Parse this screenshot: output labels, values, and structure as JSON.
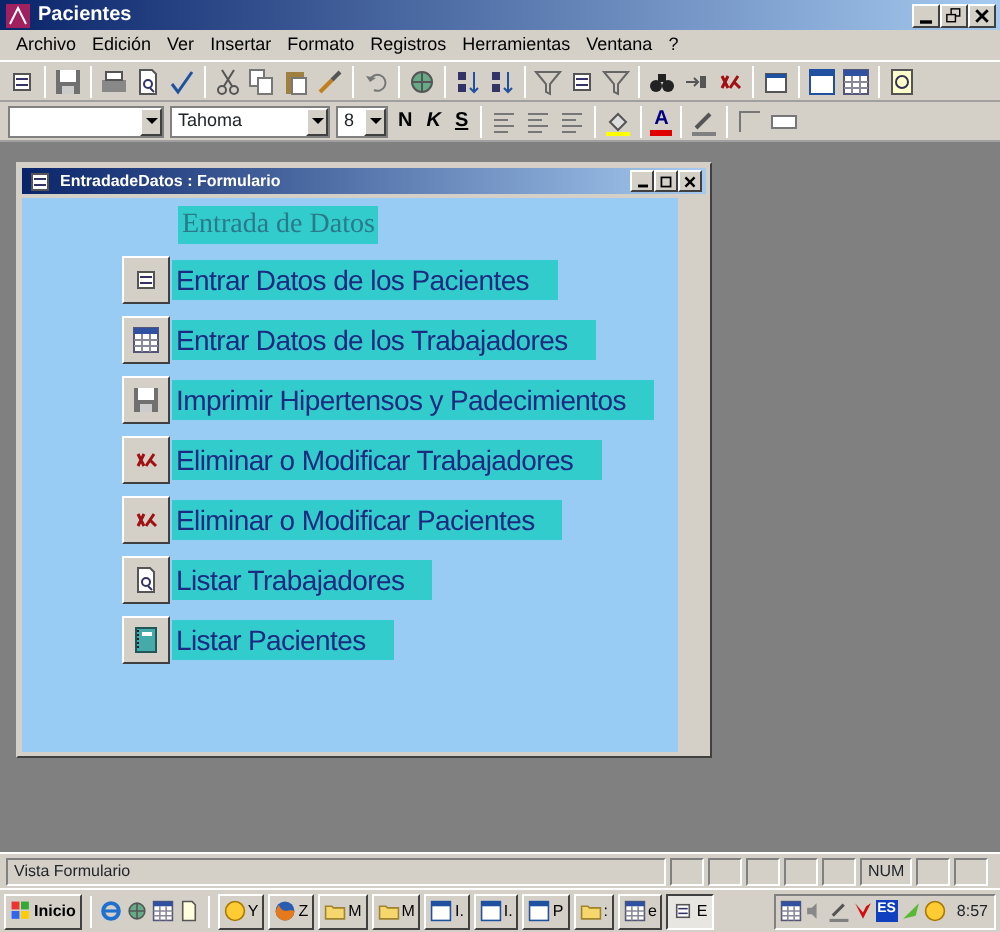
{
  "app_window": {
    "title": "Pacientes"
  },
  "menu": [
    "Archivo",
    "Edición",
    "Ver",
    "Insertar",
    "Formato",
    "Registros",
    "Herramientas",
    "Ventana",
    "?"
  ],
  "format_toolbar": {
    "font": "Tahoma",
    "size": "8",
    "bold": "N",
    "italic": "K",
    "underline": "S",
    "font_color": "A"
  },
  "form_window": {
    "title": "EntradadeDatos : Formulario",
    "heading": "Entrada  de Datos",
    "buttons": [
      {
        "kind": "form",
        "label": "Entrar  Datos de los  Pacientes"
      },
      {
        "kind": "table",
        "label": "Entrar  Datos de los Trabajadores"
      },
      {
        "kind": "save",
        "label": "Imprimir Hipertensos y Padecimientos"
      },
      {
        "kind": "delete",
        "label": "Eliminar o Modificar Trabajadores"
      },
      {
        "kind": "delete",
        "label": "Eliminar o Modificar Pacientes"
      },
      {
        "kind": "preview",
        "label": "Listar Trabajadores"
      },
      {
        "kind": "book",
        "label": "Listar Pacientes"
      }
    ]
  },
  "status_bar": {
    "text": "Vista Formulario",
    "indicator": "NUM"
  },
  "taskbar": {
    "start": "Inicio",
    "tasks": [
      {
        "label": "Y",
        "selected": false
      },
      {
        "label": "Z",
        "selected": false
      },
      {
        "label": "M",
        "selected": false
      },
      {
        "label": "M",
        "selected": false
      },
      {
        "label": "I.",
        "selected": false
      },
      {
        "label": "I.",
        "selected": false
      },
      {
        "label": "P",
        "selected": false
      },
      {
        "label": ":",
        "selected": false
      },
      {
        "label": "e",
        "selected": false
      },
      {
        "label": "E",
        "selected": true
      }
    ],
    "tray_badge": "ES",
    "clock": "8:57"
  }
}
